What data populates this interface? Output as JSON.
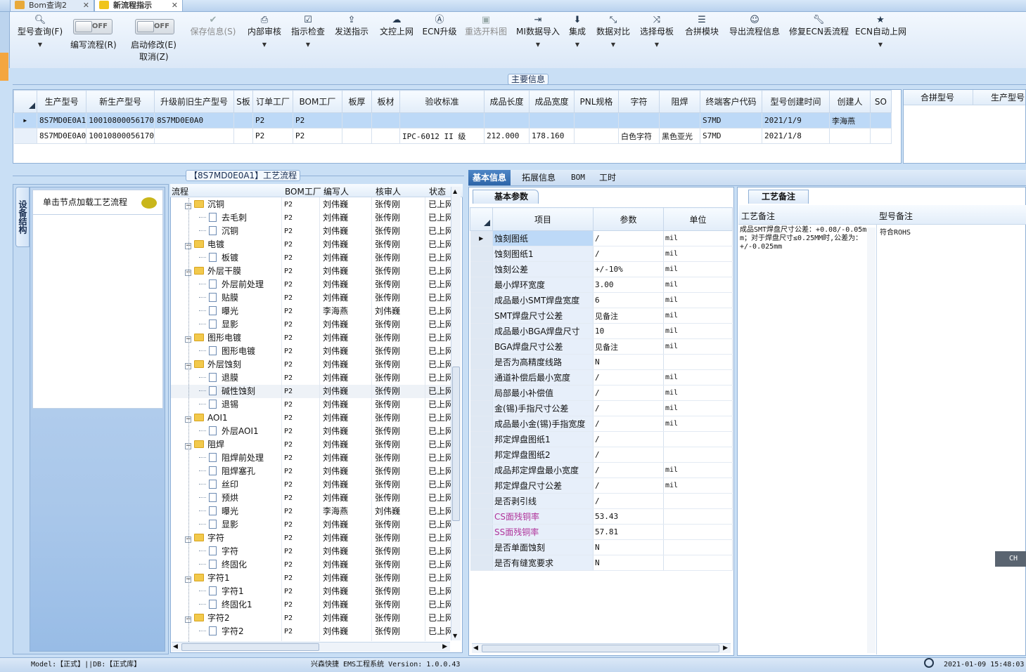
{
  "tabs": [
    {
      "label": "Bom查询2",
      "active": false
    },
    {
      "label": "新流程指示",
      "active": true
    }
  ],
  "toolbar": {
    "search": "型号查询(F)",
    "edit_flow": "编写流程(R)",
    "start_modify": "启动修改(E)",
    "cancel": "取消(Z)",
    "toggle_off": "OFF",
    "save": "保存信息(S)",
    "internal_review": "内部审核",
    "check": "指示检查",
    "send": "发送指示",
    "doc_upload": "文控上网",
    "ecn_upgrade": "ECN升级",
    "reselect": "重选开料图",
    "mi_import": "MI数据导入",
    "integrate": "集成",
    "compare": "数据对比",
    "select_master": "选择母板",
    "merge_module": "合拼模块",
    "export_flow": "导出流程信息",
    "fix_ecn": "修复ECN丢流程",
    "ecn_auto": "ECN自动上网"
  },
  "main_info_label": "主要信息",
  "main_grid": {
    "columns": [
      "生产型号",
      "新生产型号",
      "升级前旧生产型号",
      "S板",
      "订单工厂",
      "BOM工厂",
      "板厚",
      "板材",
      "验收标准",
      "成品长度",
      "成品宽度",
      "PNL规格",
      "字符",
      "阻焊",
      "终端客户代码",
      "型号创建时间",
      "创建人",
      "SO"
    ],
    "rows": [
      [
        "8S7MD0E0A1",
        "10010800056170",
        "8S7MD0E0A0",
        "",
        "P2",
        "P2",
        "",
        "",
        "",
        "",
        "",
        "",
        "",
        "",
        "S7MD",
        "2021/1/9",
        "李海燕",
        ""
      ],
      [
        "8S7MD0E0A0",
        "10010800056170",
        "",
        "",
        "P2",
        "P2",
        "",
        "",
        "IPC-6012 II 级",
        "212.000",
        "178.160",
        "",
        "白色字符",
        "黑色亚光",
        "S7MD",
        "2021/1/8",
        "",
        ""
      ]
    ]
  },
  "merge_grid": {
    "columns": [
      "合拼型号",
      "生产型号"
    ]
  },
  "flow_title": "【8S7MD0E0A1】工艺流程",
  "device_tab": "设备结构",
  "node_hint": "单击节点加载工艺流程",
  "tree": {
    "columns": [
      "流程",
      "BOM工厂",
      "编写人",
      "核审人",
      "状态"
    ],
    "rows": [
      {
        "name": "沉铜",
        "level": 0,
        "bom": "P2",
        "writer": "刘伟巍",
        "reviewer": "张传刚",
        "status": "已上网"
      },
      {
        "name": "去毛刺",
        "level": 1,
        "bom": "P2",
        "writer": "刘伟巍",
        "reviewer": "张传刚",
        "status": "已上网"
      },
      {
        "name": "沉铜",
        "level": 1,
        "bom": "P2",
        "writer": "刘伟巍",
        "reviewer": "张传刚",
        "status": "已上网"
      },
      {
        "name": "电镀",
        "level": 0,
        "bom": "P2",
        "writer": "刘伟巍",
        "reviewer": "张传刚",
        "status": "已上网"
      },
      {
        "name": "板镀",
        "level": 1,
        "bom": "P2",
        "writer": "刘伟巍",
        "reviewer": "张传刚",
        "status": "已上网"
      },
      {
        "name": "外层干膜",
        "level": 0,
        "bom": "P2",
        "writer": "刘伟巍",
        "reviewer": "张传刚",
        "status": "已上网"
      },
      {
        "name": "外层前处理",
        "level": 1,
        "bom": "P2",
        "writer": "刘伟巍",
        "reviewer": "张传刚",
        "status": "已上网"
      },
      {
        "name": "贴膜",
        "level": 1,
        "bom": "P2",
        "writer": "刘伟巍",
        "reviewer": "张传刚",
        "status": "已上网"
      },
      {
        "name": "曝光",
        "level": 1,
        "bom": "P2",
        "writer": "李海燕",
        "reviewer": "刘伟巍",
        "status": "已上网"
      },
      {
        "name": "显影",
        "level": 1,
        "bom": "P2",
        "writer": "刘伟巍",
        "reviewer": "张传刚",
        "status": "已上网"
      },
      {
        "name": "图形电镀",
        "level": 0,
        "bom": "P2",
        "writer": "刘伟巍",
        "reviewer": "张传刚",
        "status": "已上网"
      },
      {
        "name": "图形电镀",
        "level": 1,
        "bom": "P2",
        "writer": "刘伟巍",
        "reviewer": "张传刚",
        "status": "已上网"
      },
      {
        "name": "外层蚀刻",
        "level": 0,
        "bom": "P2",
        "writer": "刘伟巍",
        "reviewer": "张传刚",
        "status": "已上网"
      },
      {
        "name": "退膜",
        "level": 1,
        "bom": "P2",
        "writer": "刘伟巍",
        "reviewer": "张传刚",
        "status": "已上网"
      },
      {
        "name": "碱性蚀刻",
        "level": 1,
        "bom": "P2",
        "writer": "刘伟巍",
        "reviewer": "张传刚",
        "status": "已上网",
        "selected": true
      },
      {
        "name": "退锡",
        "level": 1,
        "bom": "P2",
        "writer": "刘伟巍",
        "reviewer": "张传刚",
        "status": "已上网"
      },
      {
        "name": "AOI1",
        "level": 0,
        "bom": "P2",
        "writer": "刘伟巍",
        "reviewer": "张传刚",
        "status": "已上网"
      },
      {
        "name": "外层AOI1",
        "level": 1,
        "bom": "P2",
        "writer": "刘伟巍",
        "reviewer": "张传刚",
        "status": "已上网"
      },
      {
        "name": "阻焊",
        "level": 0,
        "bom": "P2",
        "writer": "刘伟巍",
        "reviewer": "张传刚",
        "status": "已上网"
      },
      {
        "name": "阻焊前处理",
        "level": 1,
        "bom": "P2",
        "writer": "刘伟巍",
        "reviewer": "张传刚",
        "status": "已上网"
      },
      {
        "name": "阻焊塞孔",
        "level": 1,
        "bom": "P2",
        "writer": "刘伟巍",
        "reviewer": "张传刚",
        "status": "已上网"
      },
      {
        "name": "丝印",
        "level": 1,
        "bom": "P2",
        "writer": "刘伟巍",
        "reviewer": "张传刚",
        "status": "已上网"
      },
      {
        "name": "预烘",
        "level": 1,
        "bom": "P2",
        "writer": "刘伟巍",
        "reviewer": "张传刚",
        "status": "已上网"
      },
      {
        "name": "曝光",
        "level": 1,
        "bom": "P2",
        "writer": "李海燕",
        "reviewer": "刘伟巍",
        "status": "已上网"
      },
      {
        "name": "显影",
        "level": 1,
        "bom": "P2",
        "writer": "刘伟巍",
        "reviewer": "张传刚",
        "status": "已上网"
      },
      {
        "name": "字符",
        "level": 0,
        "bom": "P2",
        "writer": "刘伟巍",
        "reviewer": "张传刚",
        "status": "已上网"
      },
      {
        "name": "字符",
        "level": 1,
        "bom": "P2",
        "writer": "刘伟巍",
        "reviewer": "张传刚",
        "status": "已上网"
      },
      {
        "name": "终固化",
        "level": 1,
        "bom": "P2",
        "writer": "刘伟巍",
        "reviewer": "张传刚",
        "status": "已上网"
      },
      {
        "name": "字符1",
        "level": 0,
        "bom": "P2",
        "writer": "刘伟巍",
        "reviewer": "张传刚",
        "status": "已上网"
      },
      {
        "name": "字符1",
        "level": 1,
        "bom": "P2",
        "writer": "刘伟巍",
        "reviewer": "张传刚",
        "status": "已上网"
      },
      {
        "name": "终固化1",
        "level": 1,
        "bom": "P2",
        "writer": "刘伟巍",
        "reviewer": "张传刚",
        "status": "已上网"
      },
      {
        "name": "字符2",
        "level": 0,
        "bom": "P2",
        "writer": "刘伟巍",
        "reviewer": "张传刚",
        "status": "已上网"
      },
      {
        "name": "字符2",
        "level": 1,
        "bom": "P2",
        "writer": "刘伟巍",
        "reviewer": "张传刚",
        "status": "已上网"
      }
    ]
  },
  "right_tabs": [
    "基本信息",
    "拓展信息",
    "BOM",
    "工时"
  ],
  "basic_params_title": "基本参数",
  "params": {
    "columns": [
      "项目",
      "参数",
      "单位"
    ],
    "rows": [
      {
        "item": "蚀刻图纸",
        "value": "/",
        "unit": "mil"
      },
      {
        "item": "蚀刻图纸1",
        "value": "/",
        "unit": "mil"
      },
      {
        "item": "蚀刻公差",
        "value": "+/-10%",
        "unit": "mil"
      },
      {
        "item": "最小焊环宽度",
        "value": "3.00",
        "unit": "mil"
      },
      {
        "item": "成品最小SMT焊盘宽度",
        "value": "6",
        "unit": "mil"
      },
      {
        "item": "SMT焊盘尺寸公差",
        "value": "见备注",
        "unit": "mil"
      },
      {
        "item": "成品最小BGA焊盘尺寸",
        "value": "10",
        "unit": "mil"
      },
      {
        "item": "BGA焊盘尺寸公差",
        "value": "见备注",
        "unit": "mil"
      },
      {
        "item": "是否为高精度线路",
        "value": "N",
        "unit": ""
      },
      {
        "item": "通道补偿后最小宽度",
        "value": "/",
        "unit": "mil"
      },
      {
        "item": "局部最小补偿值",
        "value": "/",
        "unit": "mil"
      },
      {
        "item": "金(锡)手指尺寸公差",
        "value": "/",
        "unit": "mil"
      },
      {
        "item": "成品最小金(锡)手指宽度",
        "value": "/",
        "unit": "mil"
      },
      {
        "item": "邦定焊盘图纸1",
        "value": "/",
        "unit": ""
      },
      {
        "item": "邦定焊盘图纸2",
        "value": "/",
        "unit": ""
      },
      {
        "item": "成品邦定焊盘最小宽度",
        "value": "/",
        "unit": "mil"
      },
      {
        "item": "邦定焊盘尺寸公差",
        "value": "/",
        "unit": "mil"
      },
      {
        "item": "是否剥引线",
        "value": "/",
        "unit": ""
      },
      {
        "item": "CS面残铜率",
        "value": "53.43",
        "unit": "",
        "highlight": true
      },
      {
        "item": "SS面残铜率",
        "value": "57.81",
        "unit": "",
        "highlight": true
      },
      {
        "item": "是否单面蚀刻",
        "value": "N",
        "unit": ""
      },
      {
        "item": "是否有缝宽要求",
        "value": "N",
        "unit": ""
      }
    ]
  },
  "notes": {
    "title": "工艺备注",
    "col1": "工艺备注",
    "col2": "型号备注",
    "craft_note": "成品SMT焊盘尺寸公差：+0.08/-0.05mm；对于焊盘尺寸≤0.25MM时,公差为：+/-0.025mm",
    "model_note": "符合ROHS"
  },
  "ime": "CH",
  "status": {
    "model": "Model:【正式】||DB:【正式库】",
    "app": "兴森快捷 EMS工程系统 Version: 1.0.0.43",
    "datetime": "2021-01-09 15:48:03"
  },
  "colors": {
    "accent": "#2d65a8",
    "selected_row": "#bdd9f7",
    "panel_bg": "#c9dff5",
    "highlight_text": "#b0349b"
  }
}
